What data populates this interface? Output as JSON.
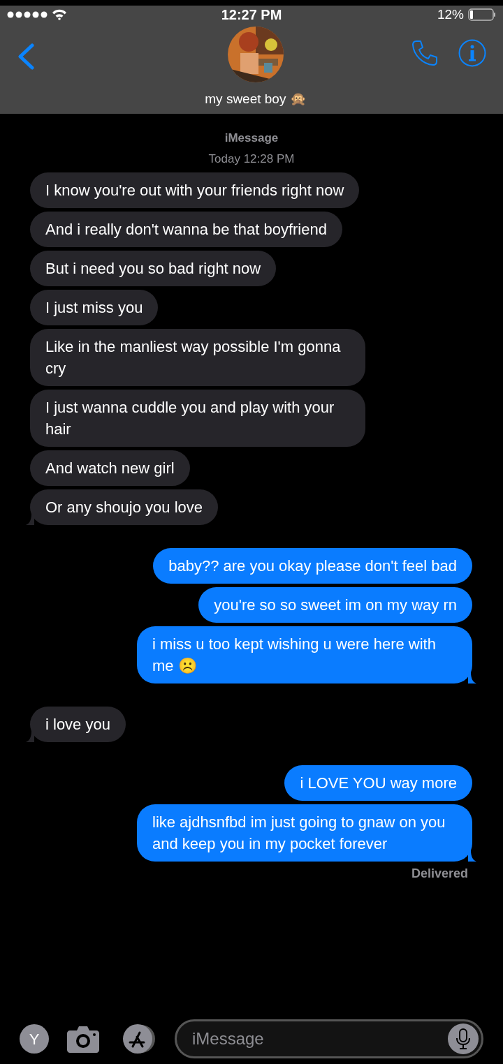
{
  "status_bar": {
    "time": "12:27 PM",
    "battery": "12%"
  },
  "header": {
    "contact": "my sweet boy 🙊"
  },
  "thread": {
    "service": "iMessage",
    "timestamp": "Today 12:28 PM"
  },
  "groups": [
    {
      "kind": "incoming",
      "messages": [
        "I know you're out with your friends right now",
        "And i really don't wanna be that boyfriend",
        "But i need you so bad right now",
        "I just miss you",
        "Like in the manliest way possible I'm gonna cry",
        "I just wanna cuddle you and play with your hair",
        "And watch new girl",
        "Or any shoujo you love"
      ]
    },
    {
      "kind": "outgoing",
      "messages": [
        "baby?? are you okay please don't feel bad",
        "you're so so sweet im on my way rn",
        "i miss u too kept wishing u were here with me ☹️"
      ]
    },
    {
      "kind": "incoming",
      "messages": [
        "i love you"
      ]
    },
    {
      "kind": "outgoing",
      "messages": [
        "i LOVE YOU way more",
        "like ajdhsnfbd im just going to gnaw on you and keep you in my pocket forever"
      ]
    }
  ],
  "delivery_status": "Delivered",
  "composer": {
    "app_initial": "Y",
    "placeholder": "iMessage"
  }
}
